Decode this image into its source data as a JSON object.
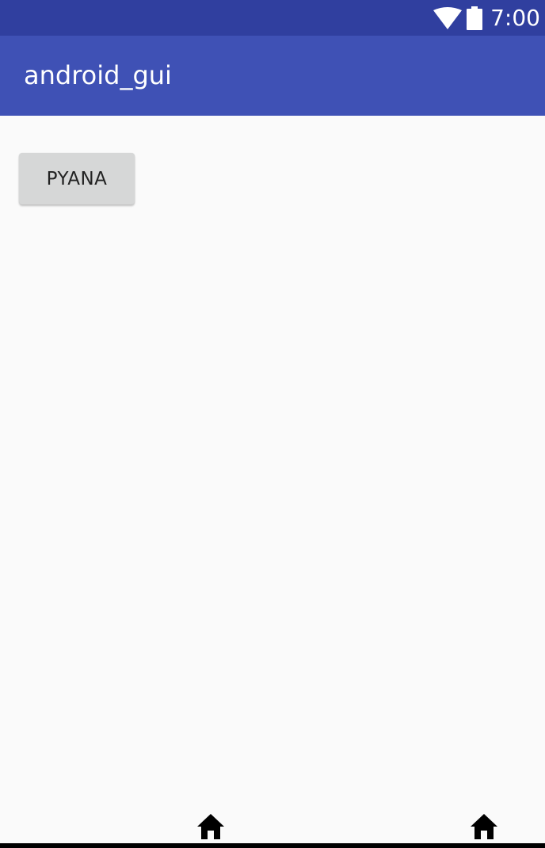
{
  "status_bar": {
    "time": "7:00",
    "icons": [
      "wifi-icon",
      "battery-icon"
    ],
    "background_color": "#303f9f"
  },
  "app_bar": {
    "title": "android_gui",
    "background_color": "#3f51b5"
  },
  "main": {
    "button_label": "PYANA",
    "button_color": "#d6d7d7"
  },
  "nav_bar": {
    "icons": [
      "home-icon",
      "home-icon"
    ]
  }
}
